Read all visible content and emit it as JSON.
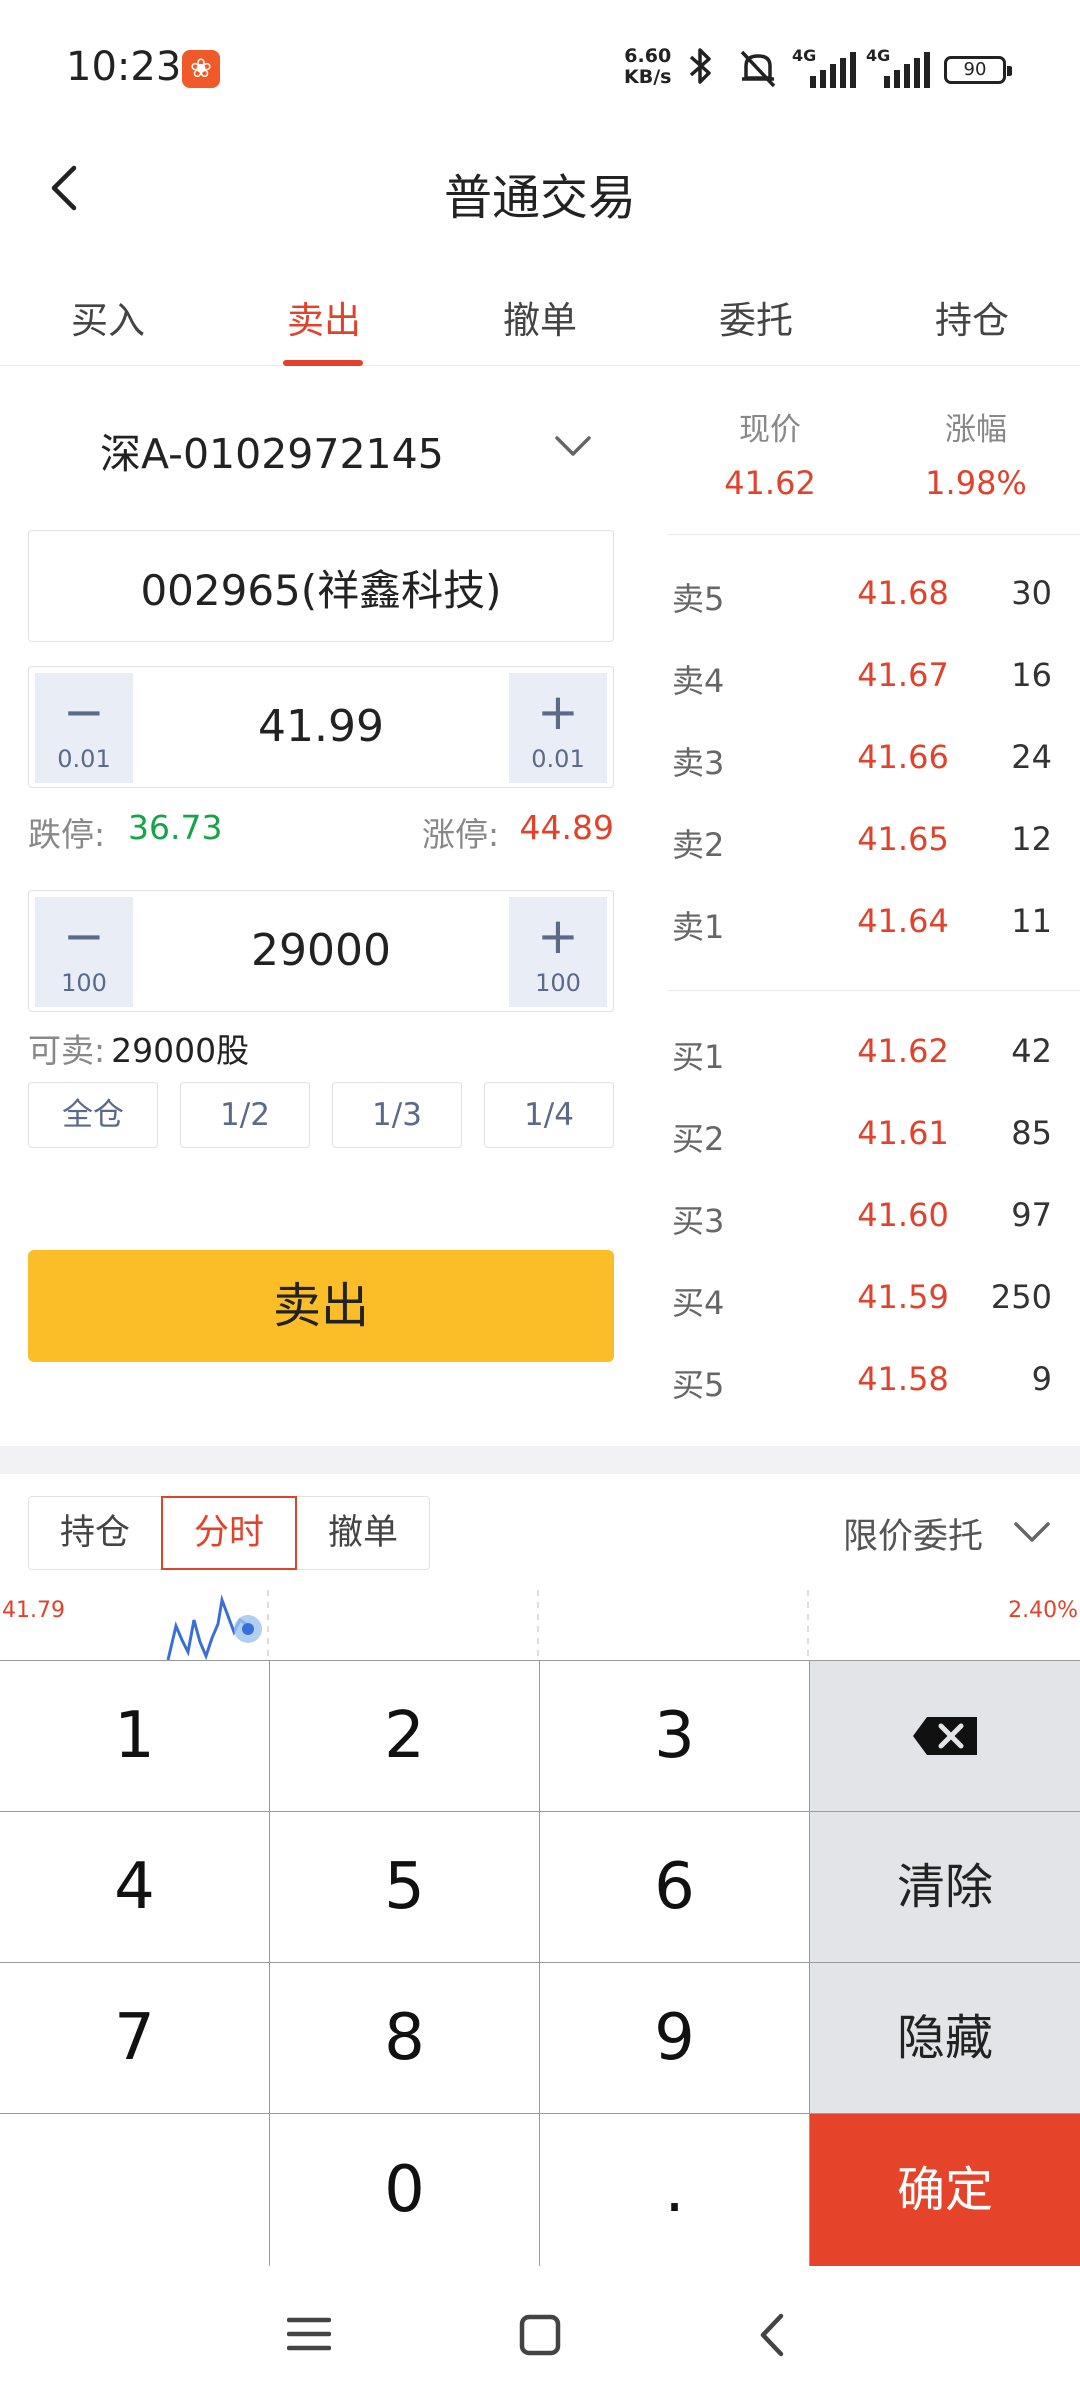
{
  "status_bar": {
    "time": "10:23",
    "app_badge": "❀",
    "net_speed_value": "6.60",
    "net_speed_unit": "KB/s",
    "network_1": "4G",
    "network_2": "4G",
    "battery": "90"
  },
  "header": {
    "title": "普通交易"
  },
  "tabs": [
    {
      "label": "买入"
    },
    {
      "label": "卖出"
    },
    {
      "label": "撤单"
    },
    {
      "label": "委托"
    },
    {
      "label": "持仓"
    }
  ],
  "active_tab": "卖出",
  "form": {
    "account": "深A-0102972145",
    "stock": "002965(祥鑫科技)",
    "price": {
      "value": "41.99",
      "minus_sign": "−",
      "plus_sign": "+",
      "step": "0.01"
    },
    "limit_down_label": "跌停:",
    "limit_down": "36.73",
    "limit_up_label": "涨停:",
    "limit_up": "44.89",
    "quantity": {
      "value": "29000",
      "minus_sign": "−",
      "plus_sign": "+",
      "step": "100"
    },
    "sellable_label": "可卖:",
    "sellable": "29000股",
    "ratios": [
      "全仓",
      "1/2",
      "1/3",
      "1/4"
    ],
    "submit_label": "卖出"
  },
  "quote": {
    "current_label": "现价",
    "current_price": "41.62",
    "change_label": "涨幅",
    "change_pct": "1.98%"
  },
  "order_book": {
    "asks": [
      {
        "label": "卖5",
        "price": "41.68",
        "volume": "30"
      },
      {
        "label": "卖4",
        "price": "41.67",
        "volume": "16"
      },
      {
        "label": "卖3",
        "price": "41.66",
        "volume": "24"
      },
      {
        "label": "卖2",
        "price": "41.65",
        "volume": "12"
      },
      {
        "label": "卖1",
        "price": "41.64",
        "volume": "11"
      }
    ],
    "bids": [
      {
        "label": "买1",
        "price": "41.62",
        "volume": "42"
      },
      {
        "label": "买2",
        "price": "41.61",
        "volume": "85"
      },
      {
        "label": "买3",
        "price": "41.60",
        "volume": "97"
      },
      {
        "label": "买4",
        "price": "41.59",
        "volume": "250"
      },
      {
        "label": "买5",
        "price": "41.58",
        "volume": "9"
      }
    ]
  },
  "lower": {
    "tabs": [
      "持仓",
      "分时",
      "撤单"
    ],
    "active": "分时",
    "order_type": "限价委托",
    "mini_chart_high": "41.79",
    "mini_chart_pct": "2.40%"
  },
  "keypad": {
    "keys": [
      "1",
      "2",
      "3",
      "4",
      "5",
      "6",
      "7",
      "8",
      "9",
      "0",
      "."
    ],
    "clear_label": "清除",
    "hide_label": "隐藏",
    "confirm_label": "确定"
  },
  "colors": {
    "accent_red": "#e0422b",
    "down_green": "#16a34a",
    "sell_button": "#fbbd28",
    "confirm_key": "#e5432a",
    "stepper_bg": "#e9edf6"
  }
}
